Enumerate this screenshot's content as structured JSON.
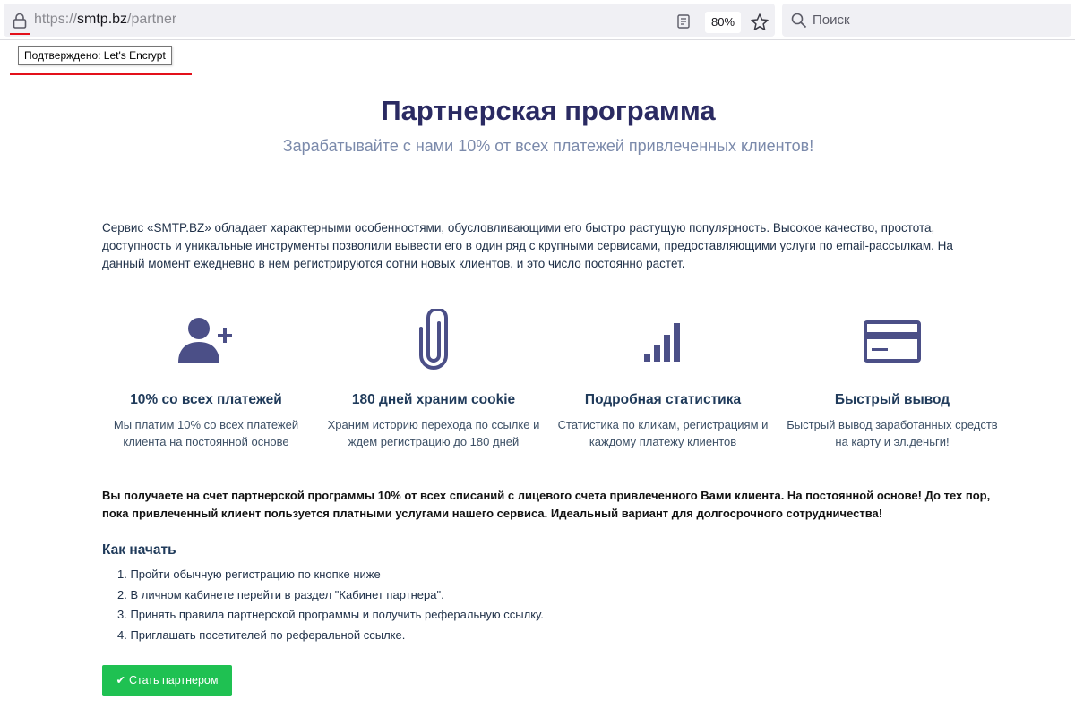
{
  "browser": {
    "url_prefix": "https://",
    "url_domain": "smtp.bz",
    "url_path": "/partner",
    "zoom": "80%",
    "search_placeholder": "Поиск",
    "tooltip": "Подтверждено: Let's Encrypt",
    "annotation_color": "#e3101a"
  },
  "page": {
    "title": "Партнерская программа",
    "subtitle": "Зарабатывайте с нами 10% от всех платежей привлеченных клиентов!",
    "intro": "Сервис «SMTP.BZ» обладает характерными особенностями, обусловливающими его быстро растущую популярность. Высокое качество, простота, доступность и уникальные инструменты позволили вывести его в один ряд с крупными сервисами, предоставляющими услуги по email-рассылкам. На данный момент ежедневно в нем регистрируются сотни новых клиентов, и это число постоянно растет.",
    "accent_color": "#4b4f87",
    "features": [
      {
        "icon": "add-user-icon",
        "title": "10% со всех платежей",
        "desc": "Мы платим 10% со всех платежей клиента на постоянной основе"
      },
      {
        "icon": "paperclip-icon",
        "title": "180 дней храним cookie",
        "desc": "Храним историю перехода по ссылке и ждем регистрацию до 180 дней"
      },
      {
        "icon": "signal-bars-icon",
        "title": "Подробная статистика",
        "desc": "Статистика по кликам, регистрациям и каждому платежу клиентов"
      },
      {
        "icon": "credit-card-icon",
        "title": "Быстрый вывод",
        "desc": "Быстрый вывод заработанных средств на карту и эл.деньги!"
      }
    ],
    "bold_text": "Вы получаете на счет партнерской программы 10% от всех списаний с лицевого счета привлеченного Вами клиента. На постоянной основе! До тех пор, пока привлеченный клиент пользуется платными услугами нашего сервиса. Идеальный вариант для долгосрочного сотрудничества!",
    "howto_title": "Как начать",
    "steps": [
      "1. Пройти обычную регистрацию по кнопке ниже",
      "2. В личном кабинете перейти в раздел \"Кабинет партнера\".",
      "3. Принять правила партнерской программы и получить реферальную ссылку.",
      "4. Приглашать посетителей по реферальной ссылке."
    ],
    "cta_label": "Стать партнером",
    "cta_color": "#1fc152"
  }
}
